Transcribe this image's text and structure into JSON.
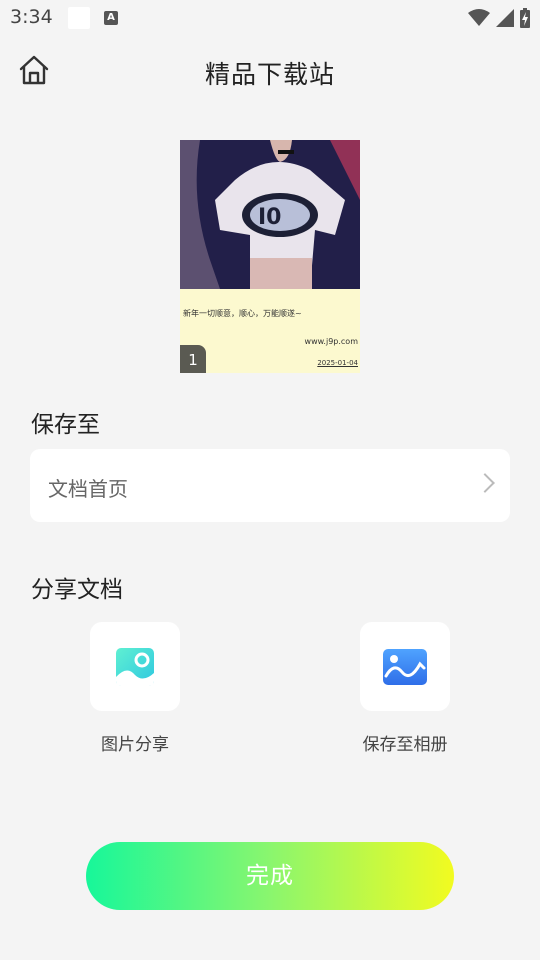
{
  "status_bar": {
    "time": "3:34",
    "a_icon": "A"
  },
  "header": {
    "title": "精品下载站"
  },
  "document": {
    "caption": "新年一切顺意，顺心，万能顺遂~",
    "site": "www.j9p.com",
    "date": "2025-01-04",
    "page_number": "1"
  },
  "save_section": {
    "heading": "保存至",
    "destination": "文档首页"
  },
  "share_section": {
    "heading": "分享文档",
    "image_share_label": "图片分享",
    "save_album_label": "保存至相册"
  },
  "done_button": {
    "label": "完成"
  },
  "colors": {
    "background": "#f4f4f4",
    "done_gradient_start": "#17f79a",
    "done_gradient_end": "#f2fb20",
    "image_icon_color": "#3ed8d6",
    "album_icon_color": "#3b7ff0"
  }
}
